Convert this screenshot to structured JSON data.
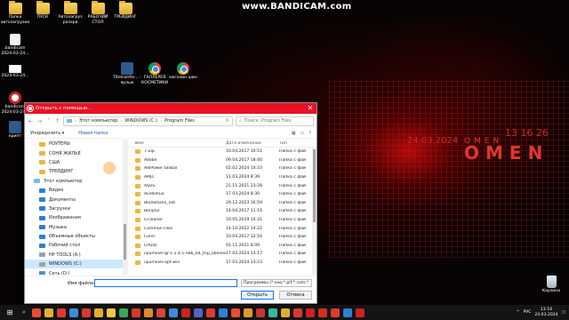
{
  "watermark": "www.BANDICAM.com",
  "desktop": {
    "icons": [
      {
        "label": "Папка автозагрузки",
        "kind": "folder"
      },
      {
        "label": "ПУСК",
        "kind": "folder"
      },
      {
        "label": "Автозагруз разерв",
        "kind": "folder"
      },
      {
        "label": "РАБОЧИЙ СТОЛ",
        "kind": "folder"
      },
      {
        "label": "ТРЕЙДИНГ",
        "kind": "folder"
      },
      {
        "label": "bandicam 2024-03-24...",
        "kind": "file"
      },
      {
        "label": "2024-03-24...",
        "kind": "white"
      },
      {
        "label": "bandicam 2024-03-24...",
        "kind": "bandi"
      },
      {
        "label": "крипт",
        "kind": "titel"
      },
      {
        "label": "Titelconfer... - ярлык",
        "kind": "titel"
      },
      {
        "label": "ГАЛЛЕРЕЯ КОСМЕТИКИ",
        "kind": "chrome"
      },
      {
        "label": "магазин шин",
        "kind": "chrome"
      },
      {
        "label": "Корзина",
        "kind": "bin"
      }
    ],
    "omen_date": "24.03.2024",
    "omen_small": "OMEN",
    "omen_big": "OMEN",
    "omen_time": "13 16 26"
  },
  "dialog": {
    "title": "Открыть с помощью...",
    "close": "✕",
    "path": [
      "Этот компьютер",
      "WINDOWS (C:)",
      "Program Files"
    ],
    "search_placeholder": "Поиск: Program Files",
    "toolbar": {
      "organize": "Упорядочить ▾",
      "new_folder": "Новая папка"
    },
    "nav": [
      {
        "label": "РОУТЕРЫ",
        "icon": "folder"
      },
      {
        "label": "СОНЯ ЖИЛЬЕ",
        "icon": "folder"
      },
      {
        "label": "США",
        "icon": "folder"
      },
      {
        "label": "ТРЕЙДИНГ",
        "icon": "folder"
      },
      {
        "label": "Этот компьютер",
        "icon": "pc"
      },
      {
        "label": "Видео",
        "icon": "blue"
      },
      {
        "label": "Документы",
        "icon": "blue"
      },
      {
        "label": "Загрузки",
        "icon": "blue"
      },
      {
        "label": "Изображения",
        "icon": "blue"
      },
      {
        "label": "Музыка",
        "icon": "music"
      },
      {
        "label": "Объемные объекты",
        "icon": "blue"
      },
      {
        "label": "Рабочий стол",
        "icon": "blue"
      },
      {
        "label": "HP TOOLS (A:)",
        "icon": "drive"
      },
      {
        "label": "WINDOWS (C:)",
        "icon": "drive",
        "selected": true
      },
      {
        "label": "Сеть (D:)",
        "icon": "net"
      }
    ],
    "columns": {
      "name": "Имя",
      "date": "Дата изменения",
      "type": "Тип"
    },
    "files": [
      {
        "name": "7-Zip",
        "date": "10.04.2017 10:51",
        "type": "Папка с фай"
      },
      {
        "name": "Adobe",
        "date": "09.04.2017 18:40",
        "type": "Папка с фай"
      },
      {
        "name": "AdiPower Global",
        "date": "02.02.2024 14:10",
        "type": "Папка с фай"
      },
      {
        "name": "AMD",
        "date": "11.03.2024 8:39",
        "type": "Папка с фай"
      },
      {
        "name": "ASUS",
        "date": "21.11.2021 23:28",
        "type": "Папка с фай"
      },
      {
        "name": "Avidemux",
        "date": "17.03.2024 8:30",
        "type": "Папка с фай"
      },
      {
        "name": "BlueStacks_nxt",
        "date": "29.12.2023 16:59",
        "type": "Папка с фай"
      },
      {
        "name": "Bonjour",
        "date": "14.04.2017 11:16",
        "type": "Папка с фай"
      },
      {
        "name": "CCleaner",
        "date": "10.05.2019 14:31",
        "type": "Папка с фай"
      },
      {
        "name": "Common Files",
        "date": "14.10.2022 14:22",
        "type": "Папка с фай"
      },
      {
        "name": "Corel",
        "date": "10.04.2017 12:16",
        "type": "Папка с фай"
      },
      {
        "name": "CPUID",
        "date": "01.11.2021 8:09",
        "type": "Папка с фай"
      },
      {
        "name": "cpuminer-gr-1.2.4.1-x86_64_tnp_obelisk",
        "date": "17.03.2024 13:17",
        "type": "Папка с фай"
      },
      {
        "name": "cpuminer-opt-win",
        "date": "17.03.2024 13:23",
        "type": "Папка с фай"
      }
    ],
    "filename_label": "Имя файла:",
    "filename_value": "",
    "filetype": "Программы (*.exe;*.pif;*.com;*.",
    "open": "Открыть",
    "cancel": "Отмена"
  },
  "taskbar": {
    "lang": "РУС",
    "time": "13:16",
    "date": "24.03.2024"
  },
  "colors": {
    "accent": "#e81123",
    "omen": "#e0352d"
  }
}
